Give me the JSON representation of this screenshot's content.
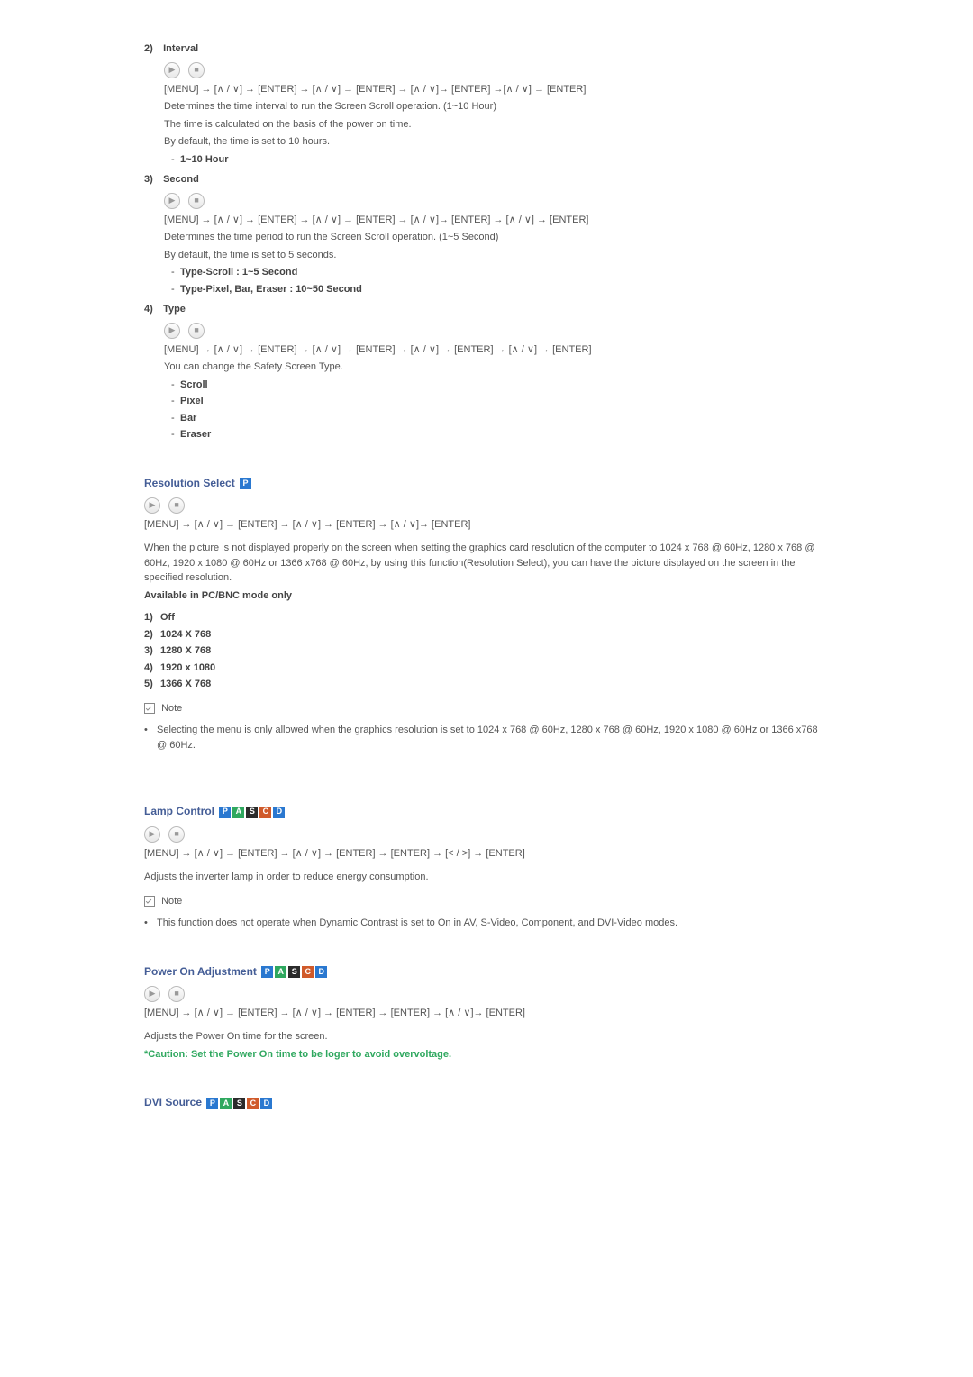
{
  "sections": {
    "interval": {
      "num": "2)",
      "title": "Interval",
      "nav": "[MENU] → [∧ / ∨] → [ENTER] → [∧ / ∨] → [ENTER] → [∧ / ∨]→ [ENTER] →[∧ / ∨] → [ENTER]",
      "desc1": "Determines the time interval to run the Screen Scroll operation. (1~10 Hour)",
      "desc2": "The time is calculated on the basis of the power on time.",
      "desc3": "By default, the time is set to 10 hours.",
      "opt1": "1~10 Hour"
    },
    "second": {
      "num": "3)",
      "title": "Second",
      "nav": "[MENU] → [∧ / ∨] → [ENTER] → [∧ / ∨] → [ENTER] → [∧ / ∨]→ [ENTER] → [∧ / ∨] → [ENTER]",
      "desc1": "Determines the time period to run the Screen Scroll operation. (1~5 Second)",
      "desc2": "By default, the time is set to 5 seconds.",
      "opt1": "Type-Scroll : 1~5 Second",
      "opt2": "Type-Pixel, Bar, Eraser : 10~50 Second"
    },
    "type": {
      "num": "4)",
      "title": "Type",
      "nav": "[MENU] → [∧ / ∨] → [ENTER] → [∧ / ∨] → [ENTER] → [∧ / ∨] → [ENTER] → [∧ / ∨] → [ENTER]",
      "desc1": "You can change the Safety Screen Type.",
      "opt1": "Scroll",
      "opt2": "Pixel",
      "opt3": "Bar",
      "opt4": "Eraser"
    },
    "resolution": {
      "title": "Resolution Select",
      "nav": "[MENU] → [∧ / ∨] → [ENTER] → [∧ / ∨] → [ENTER] → [∧ / ∨]→ [ENTER]",
      "desc": "When the picture is not displayed properly on the screen when setting the graphics card resolution of the computer to 1024 x 768 @ 60Hz, 1280 x 768 @ 60Hz, 1920 x 1080 @ 60Hz or 1366 x768 @ 60Hz, by using this function(Resolution Select), you can have the picture displayed on the screen in the specified resolution.",
      "avail": "Available in PC/BNC mode only",
      "items": {
        "n1": "1)",
        "v1": "Off",
        "n2": "2)",
        "v2": "1024 X 768",
        "n3": "3)",
        "v3": "1280 X 768",
        "n4": "4)",
        "v4": "1920 x 1080",
        "n5": "5)",
        "v5": "1366 X 768"
      },
      "note_label": "Note",
      "note": "Selecting the menu is only allowed when the graphics resolution is set to 1024 x 768 @ 60Hz, 1280 x 768 @ 60Hz, 1920 x 1080 @ 60Hz or 1366 x768 @ 60Hz."
    },
    "lamp": {
      "title": "Lamp Control",
      "nav": "[MENU] → [∧ / ∨] → [ENTER] → [∧ / ∨] → [ENTER] → [ENTER] → [< / >] → [ENTER]",
      "desc": "Adjusts the inverter lamp in order to reduce energy consumption.",
      "note_label": "Note",
      "note": "This function does not operate when Dynamic Contrast is set to On in AV, S-Video, Component, and DVI-Video modes."
    },
    "poweron": {
      "title": "Power On Adjustment",
      "nav": "[MENU] → [∧ / ∨] → [ENTER] → [∧ / ∨] → [ENTER] → [ENTER] → [∧ / ∨]→ [ENTER]",
      "desc": "Adjusts the Power On time for the screen.",
      "caution": "*Caution: Set the Power On time to be loger to avoid overvoltage."
    },
    "dvi": {
      "title": "DVI Source"
    }
  },
  "flags": {
    "p": "P",
    "a": "A",
    "s": "S",
    "c": "C",
    "d": "D"
  }
}
